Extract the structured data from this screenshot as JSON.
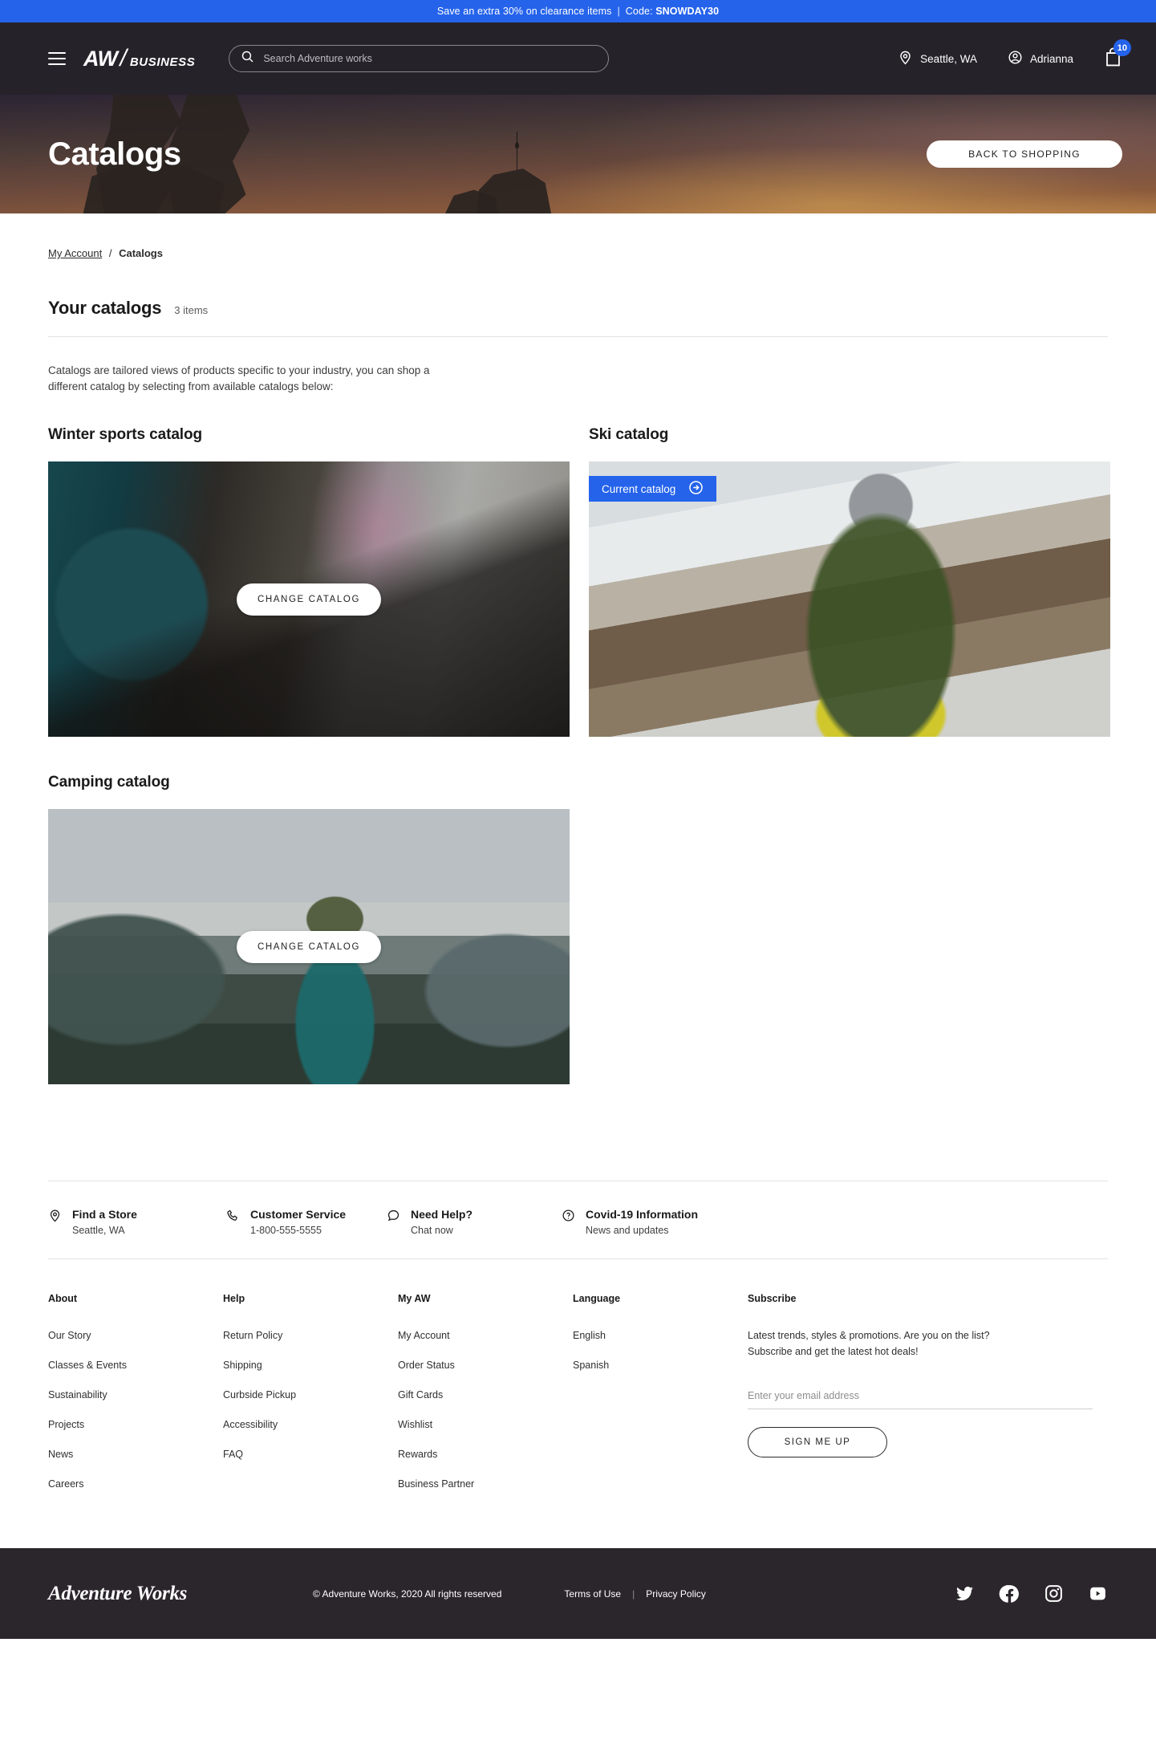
{
  "promo": {
    "text": "Save an extra 30% on clearance items",
    "separator": "|",
    "code_label": "Code:",
    "code": "SNOWDAY30",
    "bg_color": "#2563eb"
  },
  "header": {
    "brand_aw": "AW",
    "brand_slash": "/",
    "brand_business": "BUSINESS",
    "search_placeholder": "Search Adventure works",
    "search_value": "",
    "location": "Seattle, WA",
    "account": "Adrianna",
    "cart_count": "10",
    "bg_color": "#26222a"
  },
  "hero": {
    "title": "Catalogs",
    "back_button": "BACK TO SHOPPING"
  },
  "breadcrumb": {
    "parent": "My Account",
    "separator": "/",
    "current": "Catalogs"
  },
  "section": {
    "title": "Your catalogs",
    "count": "3 items",
    "intro_line1": "Catalogs are tailored views of products specific to your industry, you can shop a",
    "intro_line2": "different catalog by selecting from available catalogs below:"
  },
  "catalogs": [
    {
      "title": "Winter sports catalog",
      "is_current": false,
      "action_label": "CHANGE CATALOG",
      "photo_class": "photo-winter"
    },
    {
      "title": "Ski catalog",
      "is_current": true,
      "badge_label": "Current catalog",
      "photo_class": "photo-ski"
    },
    {
      "title": "Camping catalog",
      "is_current": false,
      "action_label": "CHANGE CATALOG",
      "photo_class": "photo-camp"
    }
  ],
  "services": [
    {
      "icon": "location-pin-icon",
      "title": "Find a Store",
      "sub": "Seattle, WA"
    },
    {
      "icon": "phone-icon",
      "title": "Customer Service",
      "sub": "1-800-555-5555"
    },
    {
      "icon": "chat-bubble-icon",
      "title": "Need Help?",
      "sub": "Chat now"
    },
    {
      "icon": "question-circle-icon",
      "title": "Covid-19 Information",
      "sub": "News and updates"
    }
  ],
  "footer_columns": [
    {
      "heading": "About",
      "links": [
        "Our Story",
        "Classes & Events",
        "Sustainability",
        "Projects",
        "News",
        "Careers"
      ]
    },
    {
      "heading": "Help",
      "links": [
        "Return Policy",
        "Shipping",
        "Curbside Pickup",
        "Accessibility",
        "FAQ"
      ]
    },
    {
      "heading": "My AW",
      "links": [
        "My Account",
        "Order Status",
        "Gift Cards",
        "Wishlist",
        "Rewards",
        "Business Partner"
      ]
    },
    {
      "heading": "Language",
      "links": [
        "English",
        "Spanish"
      ]
    }
  ],
  "subscribe": {
    "heading": "Subscribe",
    "line1": "Latest trends, styles & promotions. Are you on the list?",
    "line2": "Subscribe and get the latest hot deals!",
    "email_placeholder": "Enter your email address",
    "email_value": "",
    "button": "SIGN ME UP"
  },
  "footer_bottom": {
    "logo": "Adventure Works",
    "copyright": "© Adventure Works, 2020 All rights reserved",
    "terms": "Terms of Use",
    "divider": "|",
    "privacy": "Privacy Policy",
    "bg_color": "#2b262c",
    "social": [
      "twitter-icon",
      "facebook-icon",
      "instagram-icon",
      "youtube-icon"
    ]
  }
}
